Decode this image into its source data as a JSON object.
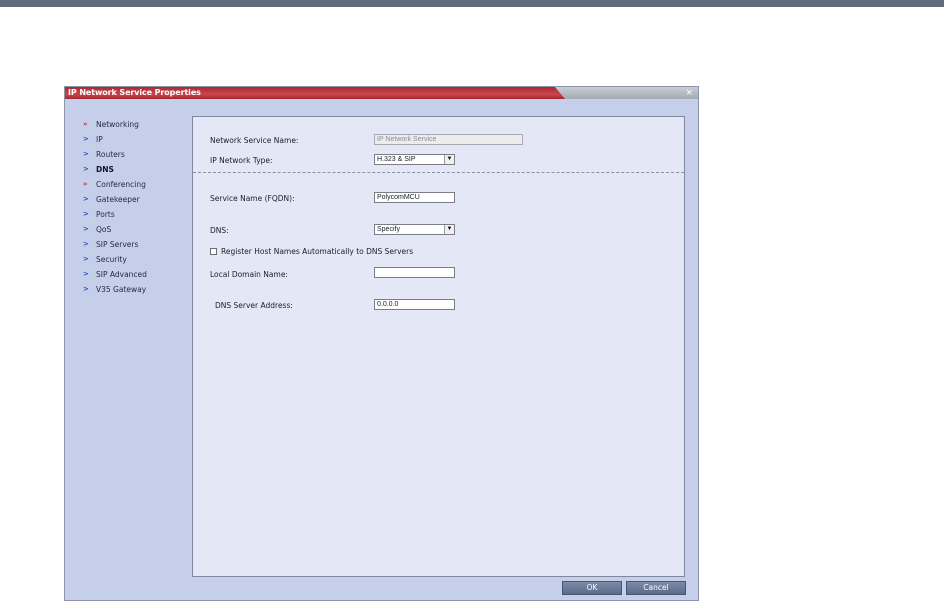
{
  "dialog": {
    "title": "IP Network Service Properties",
    "close_glyph": "×"
  },
  "nav": {
    "items": [
      {
        "label": "Networking",
        "glyph": "»"
      },
      {
        "label": "IP",
        "glyph": ">"
      },
      {
        "label": "Routers",
        "glyph": ">"
      },
      {
        "label": "DNS",
        "glyph": ">"
      },
      {
        "label": "Conferencing",
        "glyph": "»"
      },
      {
        "label": "Gatekeeper",
        "glyph": ">"
      },
      {
        "label": "Ports",
        "glyph": ">"
      },
      {
        "label": "QoS",
        "glyph": ">"
      },
      {
        "label": "SIP Servers",
        "glyph": ">"
      },
      {
        "label": "Security",
        "glyph": ">"
      },
      {
        "label": "SIP Advanced",
        "glyph": ">"
      },
      {
        "label": "V35 Gateway",
        "glyph": ">"
      }
    ]
  },
  "form": {
    "network_service_name_label": "Network Service Name:",
    "network_service_name_value": "IP Network Service",
    "ip_network_type_label": "IP Network Type:",
    "ip_network_type_value": "H.323 & SIP",
    "service_name_label": "Service Name (FQDN):",
    "service_name_value": "PolycomMCU",
    "dns_label": "DNS:",
    "dns_value": "Specify",
    "register_host_label": "Register Host Names Automatically to DNS Servers",
    "local_domain_label": "Local Domain Name:",
    "local_domain_value": "",
    "dns_server_label": "DNS Server Address:",
    "dns_server_value": "0.0.0.0",
    "dropdown_arrow": "▼"
  },
  "buttons": {
    "ok": "OK",
    "cancel": "Cancel"
  }
}
